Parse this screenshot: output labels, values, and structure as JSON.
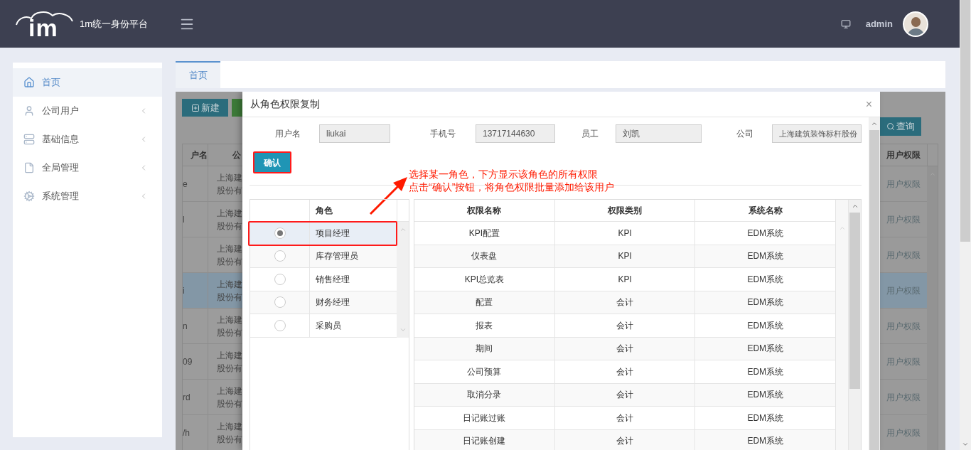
{
  "header": {
    "logo_mark": "im",
    "title": "1m统一身份平台",
    "user": "admin"
  },
  "sidebar": {
    "items": [
      {
        "label": "首页",
        "selected": true,
        "kind": "link"
      },
      {
        "label": "公司用户",
        "selected": false,
        "kind": "group"
      },
      {
        "label": "基础信息",
        "selected": false,
        "kind": "group"
      },
      {
        "label": "全局管理",
        "selected": false,
        "kind": "group"
      },
      {
        "label": "系统管理",
        "selected": false,
        "kind": "group"
      }
    ]
  },
  "tabs": [
    {
      "label": "首页",
      "selected": true
    }
  ],
  "background": {
    "new_button": "新建",
    "search_button": "查询",
    "columns": [
      "户名",
      "公",
      "用户权限"
    ],
    "rows": [
      {
        "user": "e",
        "company": [
          "上海建",
          "股份有"
        ],
        "permission": "用户权限",
        "selected": false
      },
      {
        "user": "l",
        "company": [
          "上海建",
          "股份有"
        ],
        "permission": "用户权限",
        "selected": false
      },
      {
        "company": [
          "上海建",
          "股份有"
        ],
        "permission": "用户权限",
        "selected": false
      },
      {
        "user": "i",
        "company": [
          "上海建",
          "股份有"
        ],
        "permission": "用户权限",
        "selected": true
      },
      {
        "user": "n",
        "company": [
          "上海建",
          "股份有"
        ],
        "permission": "用户权限",
        "selected": false
      },
      {
        "user": "09",
        "company": [
          "上海建",
          "股份有"
        ],
        "permission": "用户权限",
        "selected": false
      },
      {
        "user": "rd",
        "company": [
          "上海建",
          "股份有"
        ],
        "permission": "用户权限",
        "selected": false
      },
      {
        "user": "/h",
        "company": [
          "上海建",
          "股份有"
        ],
        "permission": "用户权限",
        "selected": false
      }
    ]
  },
  "modal": {
    "title": "从角色权限复制",
    "close": "×",
    "fields": [
      {
        "label": "用户名",
        "value": "liukai"
      },
      {
        "label": "手机号",
        "value": "13717144630"
      },
      {
        "label": "员工",
        "value": "刘凯"
      },
      {
        "label": "公司",
        "value": "上海建筑装饰标杆股份"
      }
    ],
    "confirm_button": "确认",
    "annotation": [
      "选择某一角色，下方显示该角色的所有权限",
      "点击“确认”按钮，将角色权限批量添加给该用户"
    ],
    "roles": {
      "column": "角色",
      "rows": [
        {
          "name": "项目经理",
          "selected": true
        },
        {
          "name": "库存管理员",
          "selected": false
        },
        {
          "name": "销售经理",
          "selected": false
        },
        {
          "name": "财务经理",
          "selected": false
        },
        {
          "name": "采购员",
          "selected": false
        }
      ]
    },
    "permissions": {
      "columns": [
        "权限名称",
        "权限类别",
        "系统名称"
      ],
      "rows": [
        [
          "KPI配置",
          "KPI",
          "EDM系统"
        ],
        [
          "仪表盘",
          "KPI",
          "EDM系统"
        ],
        [
          "KPI总览表",
          "KPI",
          "EDM系统"
        ],
        [
          "配置",
          "会计",
          "EDM系统"
        ],
        [
          "报表",
          "会计",
          "EDM系统"
        ],
        [
          "期间",
          "会计",
          "EDM系统"
        ],
        [
          "公司预算",
          "会计",
          "EDM系统"
        ],
        [
          "取消分录",
          "会计",
          "EDM系统"
        ],
        [
          "日记账过账",
          "会计",
          "EDM系统"
        ],
        [
          "日记账创建",
          "会计",
          "EDM系统"
        ]
      ]
    }
  }
}
